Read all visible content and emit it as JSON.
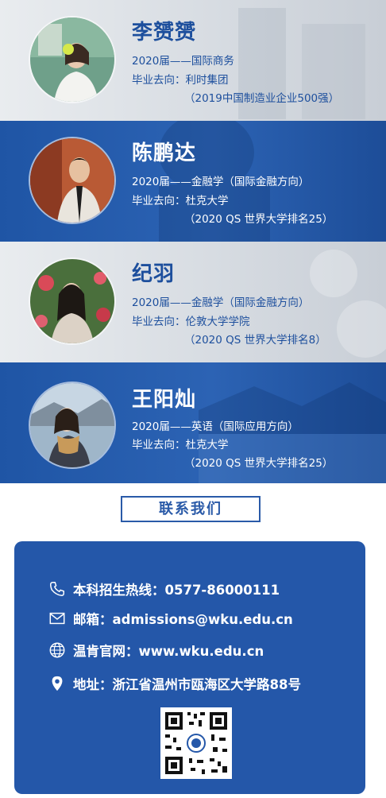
{
  "alumni": [
    {
      "name": "李赟赟",
      "line1": "2020届——国际商务",
      "line2": "毕业去向：利时集团",
      "line3": "（2019中国制造业企业500强）"
    },
    {
      "name": "陈鹏达",
      "line1": "2020届——金融学（国际金融方向）",
      "line2": "毕业去向：杜克大学",
      "line3": "（2020 QS 世界大学排名25）"
    },
    {
      "name": "纪羽",
      "line1": "2020届——金融学（国际金融方向）",
      "line2": "毕业去向：伦敦大学学院",
      "line3": "（2020 QS 世界大学排名8）"
    },
    {
      "name": "王阳灿",
      "line1": "2020届——英语（国际应用方向）",
      "line2": "毕业去向：杜克大学",
      "line3": "（2020 QS 世界大学排名25）"
    }
  ],
  "contact": {
    "title": "联系我们",
    "hotline": "本科招生热线：0577-86000111",
    "email": "邮箱：admissions@wku.edu.cn",
    "website": "温肯官网：www.wku.edu.cn",
    "address": "地址：浙江省温州市瓯海区大学路88号"
  },
  "colors": {
    "brand_blue": "#2457a9",
    "light_band": "#dfe3e8"
  }
}
